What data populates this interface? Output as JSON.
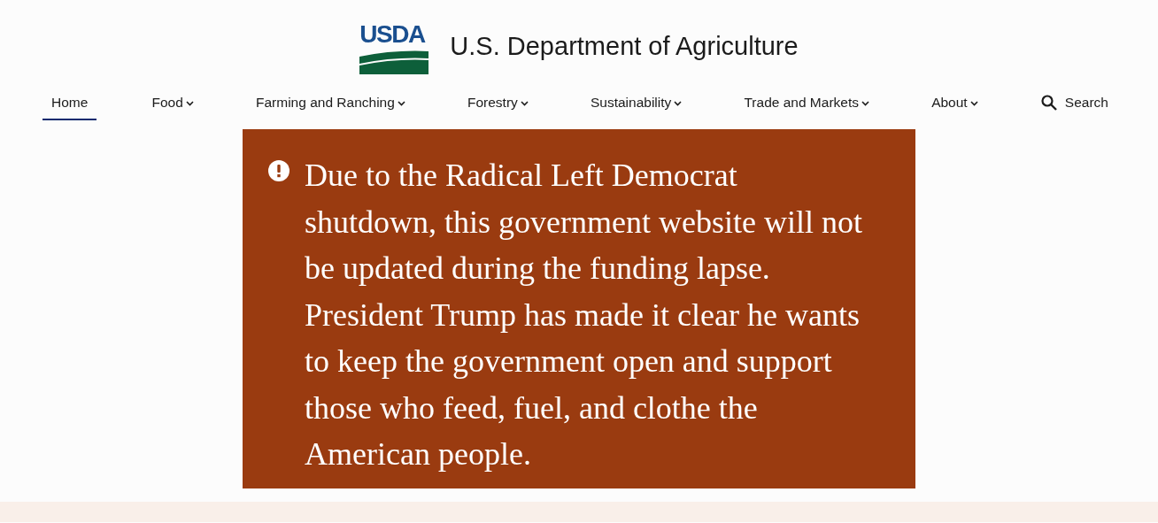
{
  "header": {
    "logo_text": "USDA",
    "title": "U.S. Department of Agriculture"
  },
  "nav": [
    {
      "label": "Home",
      "selected": true,
      "has_menu": false
    },
    {
      "label": "Food",
      "selected": false,
      "has_menu": true
    },
    {
      "label": "Farming and Ranching",
      "selected": false,
      "has_menu": true
    },
    {
      "label": "Forestry",
      "selected": false,
      "has_menu": true
    },
    {
      "label": "Sustainability",
      "selected": false,
      "has_menu": true
    },
    {
      "label": "Trade and Markets",
      "selected": false,
      "has_menu": true
    },
    {
      "label": "About",
      "selected": false,
      "has_menu": true
    }
  ],
  "search": {
    "label": "Search"
  },
  "alert": {
    "message": "Due to the Radical Left Democrat shutdown, this government website will not be updated during the funding lapse. President Trump has made it clear he wants to keep the government open and support those who feed, fuel, and clothe the American people."
  }
}
